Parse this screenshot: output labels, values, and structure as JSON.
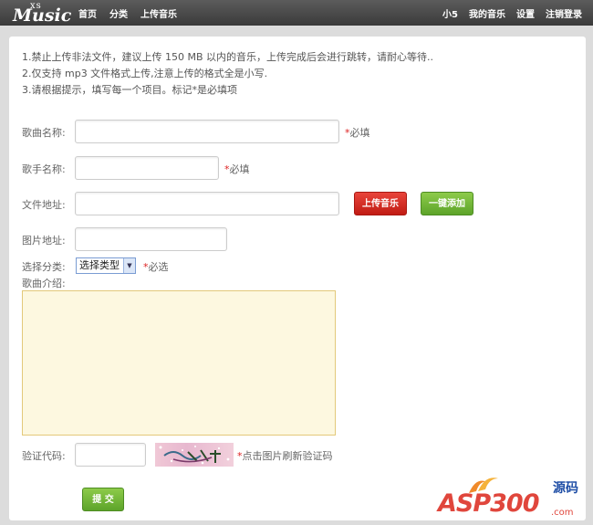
{
  "nav": {
    "logo_small": "xs",
    "logo_big": "Music",
    "left_links": [
      "首页",
      "分类",
      "上传音乐"
    ],
    "right_links": [
      "小5",
      "我的音乐",
      "设置",
      "注销登录"
    ]
  },
  "notice": [
    "1.禁止上传非法文件，建议上传 150 MB 以内的音乐，上传完成后会进行跳转，请耐心等待..",
    "2.仅支持 mp3 文件格式上传,注意上传的格式全是小写.",
    "3.请根据提示，填写每一个项目。标记*是必填项"
  ],
  "form": {
    "song_name_label": "歌曲名称:",
    "song_name_value": "",
    "song_name_required": "必填",
    "singer_label": "歌手名称:",
    "singer_value": "",
    "singer_required": "必填",
    "file_label": "文件地址:",
    "file_value": "",
    "upload_button": "上传音乐",
    "quick_add_button": "一键添加",
    "image_label": "图片地址:",
    "image_value": "",
    "category_label": "选择分类:",
    "category_selected": "选择类型",
    "category_required": "必选",
    "intro_label": "歌曲介绍:",
    "intro_value": "",
    "captcha_label": "验证代码:",
    "captcha_value": "",
    "captcha_hint": "点击图片刷新验证码",
    "submit_button": "提 交"
  },
  "watermark": {
    "text": "ASP300",
    "cn": "源码",
    "domain": ".com"
  },
  "colors": {
    "topbar": "#3a3a3a",
    "required_star": "#dd2222",
    "upload_button": "#c11c14",
    "green_button": "#5da42a",
    "textarea_bg": "#fdf8e0"
  }
}
